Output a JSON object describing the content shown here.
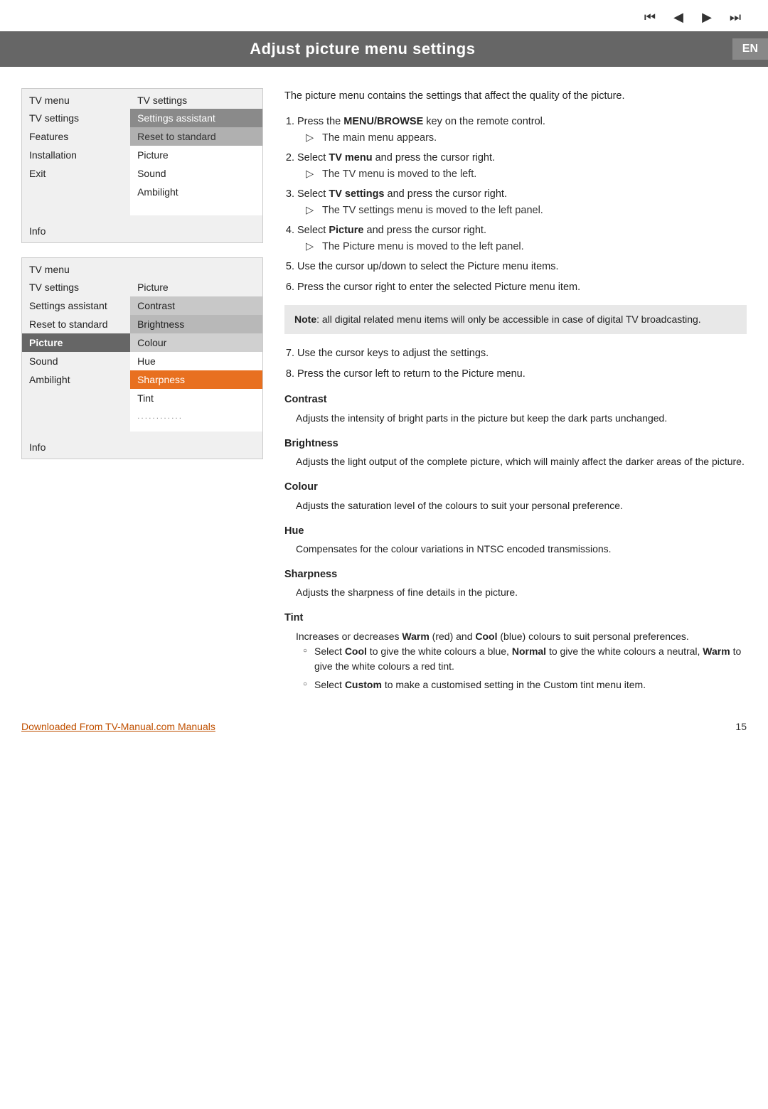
{
  "nav": {
    "btn1": "⏮",
    "btn2": "◀",
    "btn3": "▶",
    "btn4": "⏭"
  },
  "header": {
    "title": "Adjust picture menu settings",
    "badge": "EN"
  },
  "menu1": {
    "header_left": "TV menu",
    "header_right": "TV settings",
    "rows": [
      {
        "left": "TV settings",
        "right": "Settings assistant",
        "style": "dark"
      },
      {
        "left": "Features",
        "right": "Reset to standard",
        "style": "med"
      },
      {
        "left": "Installation",
        "right": "Picture",
        "style": "plain"
      },
      {
        "left": "Exit",
        "right": "Sound",
        "style": "plain"
      },
      {
        "left": "",
        "right": "Ambilight",
        "style": "plain"
      },
      {
        "left": "",
        "right": "",
        "style": "empty"
      },
      {
        "left": "",
        "right": "",
        "style": "empty"
      }
    ],
    "info": "Info"
  },
  "menu2": {
    "header_left": "TV menu",
    "header_right": "",
    "subheader_left": "TV settings",
    "subheader_right": "Picture",
    "rows": [
      {
        "left": "Settings assistant",
        "right": "Contrast",
        "style": "plain"
      },
      {
        "left": "Reset to standard",
        "right": "Brightness",
        "style": "med"
      },
      {
        "left": "Picture",
        "right": "Colour",
        "style": "left-highlight"
      },
      {
        "left": "Sound",
        "right": "Hue",
        "style": "plain"
      },
      {
        "left": "Ambilight",
        "right": "Sharpness",
        "style": "orange"
      },
      {
        "left": "",
        "right": "Tint",
        "style": "plain"
      },
      {
        "left": "",
        "right": "............",
        "style": "plain"
      },
      {
        "left": "",
        "right": "",
        "style": "empty"
      }
    ],
    "info": "Info"
  },
  "intro": "The picture menu contains the settings that affect the quality of the picture.",
  "steps": [
    {
      "main": "Press the MENU/BROWSE key on the remote control.",
      "main_bold": "MENU/BROWSE",
      "sub": "The main menu appears."
    },
    {
      "main": "Select TV menu and press the cursor right.",
      "main_bold": "TV menu",
      "sub": "The TV menu is moved to the left."
    },
    {
      "main": "Select TV settings and press the cursor right.",
      "main_bold": "TV settings",
      "sub": "The TV settings menu is moved to the left panel."
    },
    {
      "main": "Select Picture and press the cursor right.",
      "main_bold": "Picture",
      "sub": "The Picture menu is moved to the left panel."
    },
    {
      "main": "Use the cursor up/down to select the Picture menu items.",
      "main_bold": ""
    },
    {
      "main": "Press the cursor right to enter the selected Picture menu item.",
      "main_bold": ""
    }
  ],
  "note": "Note: all digital related menu items will only be accessible in case of digital TV broadcasting.",
  "steps2": [
    {
      "main": "Use the cursor keys to adjust the settings.",
      "main_bold": ""
    },
    {
      "main": "Press the cursor left to return to the Picture menu.",
      "main_bold": ""
    }
  ],
  "sections": [
    {
      "title": "Contrast",
      "body": "Adjusts the intensity of bright parts in the picture but keep the dark parts unchanged."
    },
    {
      "title": "Brightness",
      "body": "Adjusts the light output of the complete picture, which will mainly affect the darker areas of the picture."
    },
    {
      "title": "Colour",
      "body": "Adjusts the saturation level of the colours to suit your personal preference."
    },
    {
      "title": "Hue",
      "body": "Compensates for the colour variations in NTSC encoded transmissions."
    },
    {
      "title": "Sharpness",
      "body": "Adjusts the sharpness of fine details in the picture."
    },
    {
      "title": "Tint",
      "body": "Increases or decreases Warm (red) and Cool (blue) colours to suit personal preferences."
    }
  ],
  "tint_bullets": [
    "Select Cool to give the white colours a blue, Normal to give the white colours a neutral, Warm to give the white colours a red tint.",
    "Select Custom to make a customised setting in the Custom tint menu item."
  ],
  "footer_link": "Downloaded From TV-Manual.com Manuals",
  "page_number": "15"
}
